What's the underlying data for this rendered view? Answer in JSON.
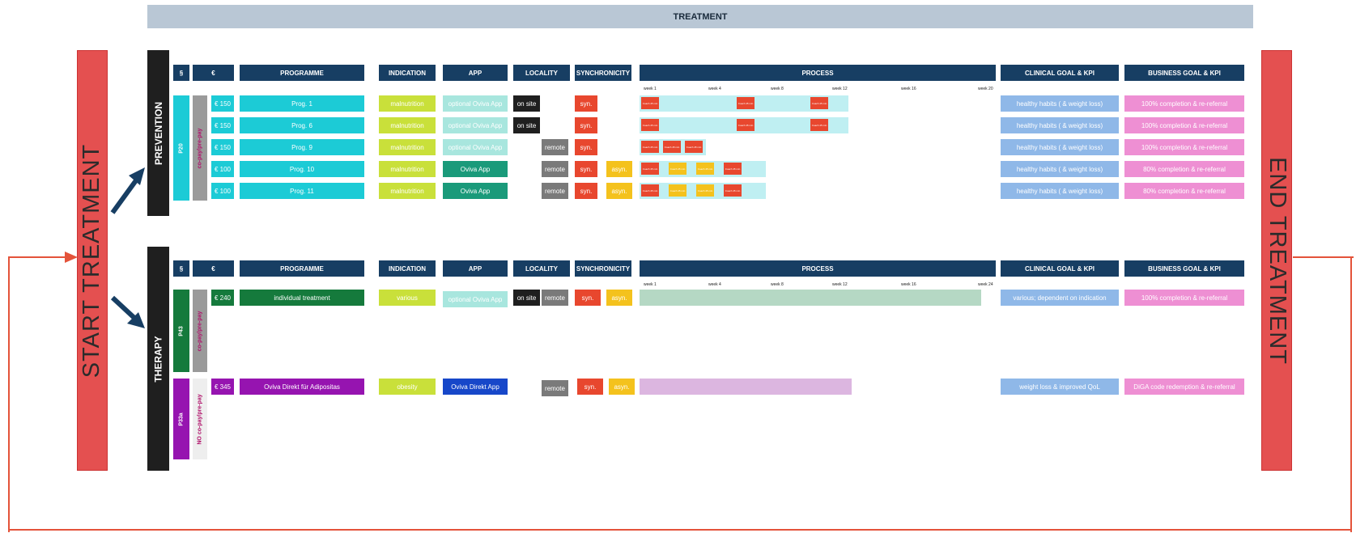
{
  "title": "TREATMENT",
  "start_label": "START TREATMENT",
  "end_label": "END TREATMENT",
  "headers": {
    "para": "§",
    "price": "€",
    "programme": "PROGRAMME",
    "indication": "INDICATION",
    "app": "APP",
    "locality": "LOCALITY",
    "synchronicity": "SYNCHRONICITY",
    "process": "PROCESS",
    "clinical": "CLINICAL GOAL & KPI",
    "business": "BUSINESS GOAL & KPI"
  },
  "weeks": [
    "week 1",
    "week 4",
    "week 8",
    "week 12",
    "week 16",
    "week 20"
  ],
  "weeks_therapy": [
    "week 1",
    "week 4",
    "week 8",
    "week 12",
    "week 16",
    "week 24"
  ],
  "box_text": "Coach 45 min",
  "prevention": {
    "label": "PREVENTION",
    "para": "P20",
    "payment": "co-pay/pre-pay",
    "rows": [
      {
        "price": "€ 150",
        "programme": "Prog. 1",
        "indication": "malnutrition",
        "app": "optional Oviva App",
        "locality": "on site",
        "syn": "syn."
      },
      {
        "price": "€ 150",
        "programme": "Prog. 6",
        "indication": "malnutrition",
        "app": "optional Oviva App",
        "locality": "on site",
        "syn": "syn."
      },
      {
        "price": "€ 150",
        "programme": "Prog. 9",
        "indication": "malnutrition",
        "app": "optional Oviva App",
        "locality": "remote",
        "syn": "syn."
      },
      {
        "price": "€ 100",
        "programme": "Prog. 10",
        "indication": "malnutrition",
        "app": "Oviva App",
        "locality": "remote",
        "syn": "syn.",
        "asyn": "asyn."
      },
      {
        "price": "€ 100",
        "programme": "Prog. 11",
        "indication": "malnutrition",
        "app": "Oviva App",
        "locality": "remote",
        "syn": "syn.",
        "asyn": "asyn."
      }
    ],
    "clinical": "healthy habits ( & weight loss)",
    "business": [
      "100% completion & re-referral",
      "100% completion & re-referral",
      "100% completion & re-referral",
      "80% completion & re-referral",
      "80% completion & re-referral"
    ]
  },
  "therapy": {
    "label": "THERAPY",
    "rows": [
      {
        "para": "P43",
        "payment": "co-pay/pre-pay",
        "price": "€ 240",
        "programme": "individual treatment",
        "indication": "various",
        "app": "optional Oviva App",
        "locality1": "on site",
        "locality2": "remote",
        "syn": "syn.",
        "asyn": "asyn.",
        "clinical": "various; dependent on indication",
        "business": "100% completion & re-referral"
      },
      {
        "para": "P33a",
        "payment": "NO co-pay/pre-pay",
        "price": "€ 345",
        "programme": "Oviva Direkt für Adipositas",
        "indication": "obesity",
        "app": "Oviva Direkt App",
        "locality": "remote",
        "syn": "syn.",
        "asyn": "asyn.",
        "clinical": "weight loss & improved QoL",
        "business": "DiGA code redemption & re-referral"
      }
    ]
  },
  "colors": {
    "teal": "#1ccbd6",
    "lime": "#c9e03a",
    "mint": "#a8e6de",
    "green": "#1a9a7a",
    "red": "#e8472e",
    "yellow": "#f4c21d",
    "lightblue": "#8fb8e8",
    "pink": "#ee8fd3",
    "navy": "#173e63",
    "darkgreen": "#157a3c",
    "purple": "#9614b0",
    "blue": "#1747c9"
  }
}
